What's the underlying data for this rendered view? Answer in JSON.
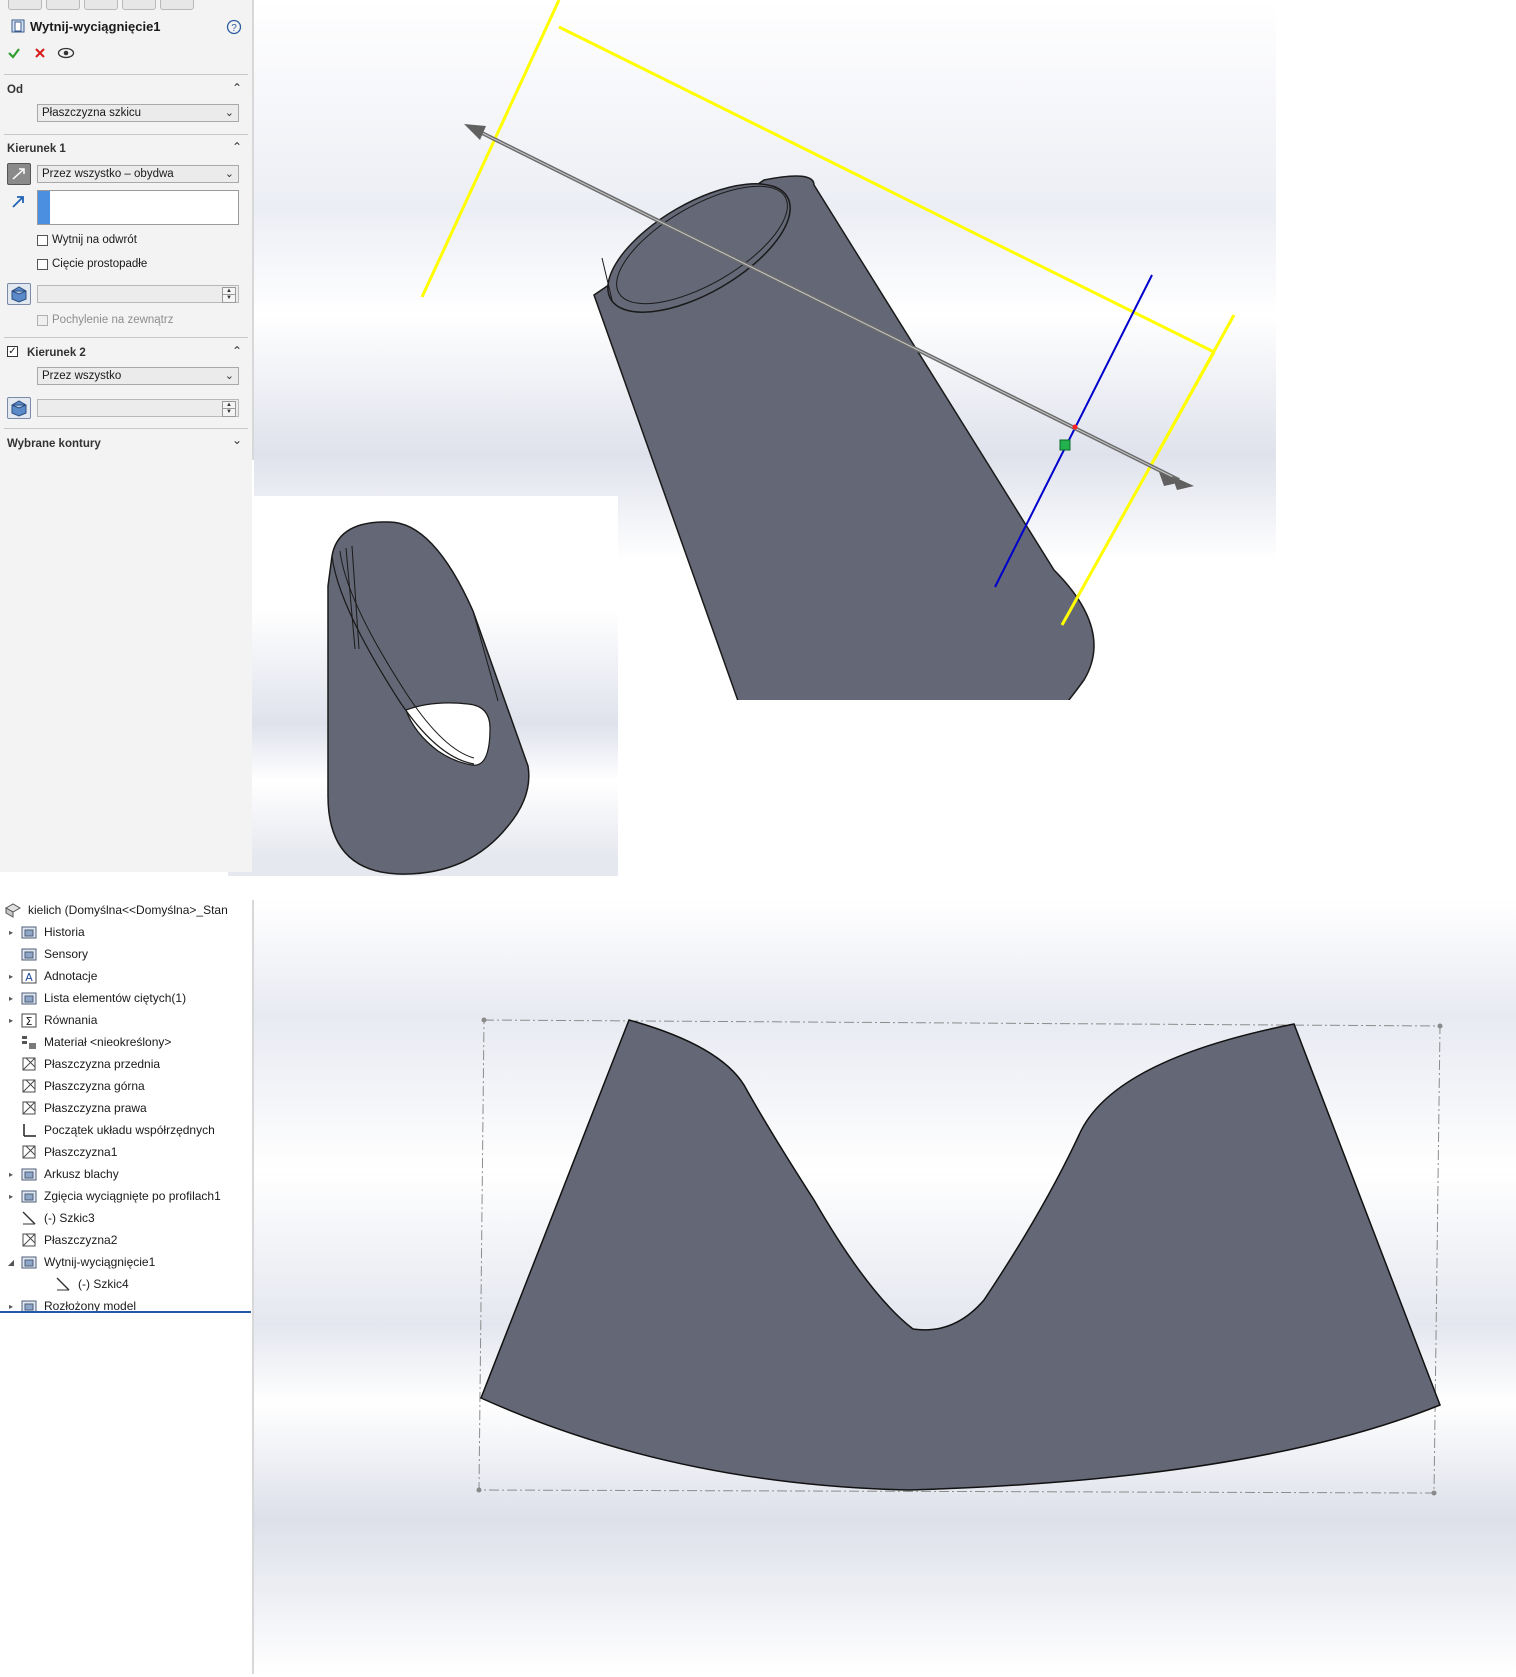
{
  "property_manager": {
    "title": "Wytnij-wyciągnięcie1",
    "sections": {
      "od": {
        "label": "Od",
        "dropdown_value": "Płaszczyzna szkicu"
      },
      "kierunek1": {
        "label": "Kierunek 1",
        "end_condition": "Przez wszystko – obydwa",
        "checkbox_flip": "Wytnij na odwrót",
        "checkbox_normal": "Cięcie prostopadłe",
        "checkbox_draft_outward": "Pochylenie na zewnątrz"
      },
      "kierunek2": {
        "label": "Kierunek 2",
        "end_condition": "Przez wszystko",
        "checked": true
      },
      "selected_contours": {
        "label": "Wybrane kontury"
      }
    },
    "icons": {
      "ok": "check-icon",
      "cancel": "close-icon",
      "preview": "eye-icon",
      "help": "help-icon"
    }
  },
  "feature_tree": {
    "root": "kielich  (Domyślna<<Domyślna>_Stan",
    "items": [
      {
        "label": "Historia",
        "expandable": true,
        "icon": "history-folder-icon"
      },
      {
        "label": "Sensory",
        "expandable": false,
        "icon": "sensor-icon"
      },
      {
        "label": "Adnotacje",
        "expandable": true,
        "icon": "annotation-icon"
      },
      {
        "label": "Lista elementów ciętych(1)",
        "expandable": true,
        "icon": "cut-list-icon"
      },
      {
        "label": "Równania",
        "expandable": true,
        "icon": "equation-icon"
      },
      {
        "label": "Materiał <nieokreślony>",
        "expandable": false,
        "icon": "material-icon"
      },
      {
        "label": "Płaszczyzna przednia",
        "expandable": false,
        "icon": "plane-icon"
      },
      {
        "label": "Płaszczyzna górna",
        "expandable": false,
        "icon": "plane-icon"
      },
      {
        "label": "Płaszczyzna prawa",
        "expandable": false,
        "icon": "plane-icon"
      },
      {
        "label": "Początek układu współrzędnych",
        "expandable": false,
        "icon": "origin-icon"
      },
      {
        "label": "Płaszczyzna1",
        "expandable": false,
        "icon": "plane-icon"
      },
      {
        "label": "Arkusz blachy",
        "expandable": true,
        "icon": "sheet-metal-icon"
      },
      {
        "label": "Zgięcia wyciągnięte po profilach1",
        "expandable": true,
        "icon": "lofted-bend-icon"
      },
      {
        "label": "(-) Szkic3",
        "expandable": false,
        "icon": "sketch-icon"
      },
      {
        "label": "Płaszczyzna2",
        "expandable": false,
        "icon": "plane-icon"
      },
      {
        "label": "Wytnij-wyciągnięcie1",
        "expandable": true,
        "expanded": true,
        "icon": "cut-extrude-icon"
      },
      {
        "label": "(-) Szkic4",
        "expandable": false,
        "child": true,
        "icon": "sketch-icon"
      },
      {
        "label": "Rozłożony model",
        "expandable": true,
        "icon": "flat-pattern-icon"
      }
    ]
  },
  "colors": {
    "part_body": "#646775",
    "sketch_line": "#ffff00",
    "axis_line": "#0000cc",
    "direction_arrow": "#707070",
    "tree_selection_underline": "#2458a8"
  }
}
